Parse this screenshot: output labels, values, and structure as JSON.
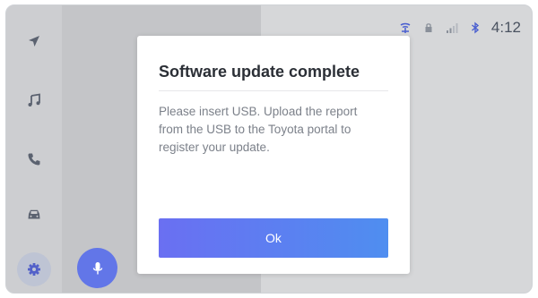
{
  "status_bar": {
    "time": "4:12",
    "icons": [
      "connected-services-icon",
      "lock-icon",
      "signal-icon",
      "bluetooth-icon"
    ]
  },
  "sidebar": {
    "items": [
      {
        "name": "navigation",
        "icon": "navigation-arrow-icon"
      },
      {
        "name": "media",
        "icon": "music-note-icon"
      },
      {
        "name": "phone",
        "icon": "phone-icon"
      },
      {
        "name": "vehicle",
        "icon": "car-icon"
      },
      {
        "name": "settings",
        "icon": "gear-icon",
        "selected": true
      }
    ]
  },
  "voice": {
    "icon": "microphone-icon",
    "color": "#6276e8"
  },
  "dialog": {
    "title": "Software update complete",
    "message": "Please insert USB. Upload the report from the USB to the Toyota portal to register your update.",
    "ok_label": "Ok"
  },
  "colors": {
    "accent_start": "#6a6ff2",
    "accent_end": "#4f8ef0",
    "background": "#d6d7d9",
    "icon": "#5b6270"
  }
}
